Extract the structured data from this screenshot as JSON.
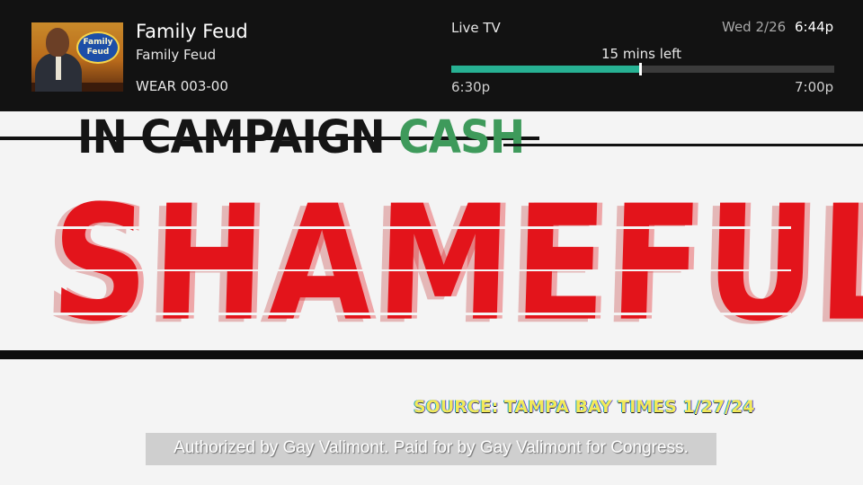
{
  "overlay": {
    "program_title": "Family Feud",
    "program_subtitle": "Family Feud",
    "channel": "WEAR 003-00",
    "thumbnail_logo_text": "Family Feud",
    "live_label": "Live TV",
    "date": "Wed 2/26",
    "time": "6:44p",
    "time_left": "15 mins left",
    "start_time": "6:30p",
    "end_time": "7:00p",
    "progress": 0.493,
    "progress_color": "#27b193"
  },
  "ad": {
    "line_partial_top": "IN CAMPAIGN",
    "line_partial_cash": "CASH",
    "headline": "SHAMEFUL",
    "source": "SOURCE: TAMPA BAY TIMES 1/27/24",
    "disclaimer": "Authorized by Gay Valimont. Paid for by Gay Valimont for Congress.",
    "headline_color": "#e3141b",
    "cash_color": "#3e9a5b"
  }
}
